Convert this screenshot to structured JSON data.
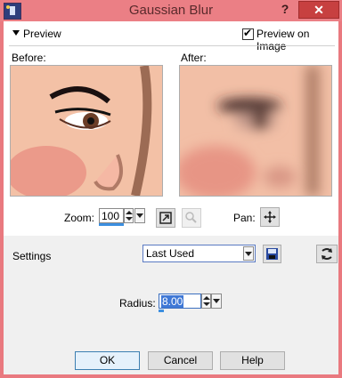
{
  "window": {
    "title": "Gaussian Blur"
  },
  "preview": {
    "toggle_label": "Preview",
    "preview_on_image_label": "Preview on Image",
    "preview_on_image_checked": true,
    "before_label": "Before:",
    "after_label": "After:"
  },
  "zoom": {
    "label": "Zoom:",
    "value": "100",
    "pan_label": "Pan:"
  },
  "settings": {
    "label": "Settings",
    "preset_value": "Last Used"
  },
  "radius": {
    "label": "Radius:",
    "value": "8.00"
  },
  "buttons": {
    "ok": "OK",
    "cancel": "Cancel",
    "help": "Help"
  },
  "titlebar_buttons": {
    "help_glyph": "?",
    "close_glyph": "✕"
  }
}
